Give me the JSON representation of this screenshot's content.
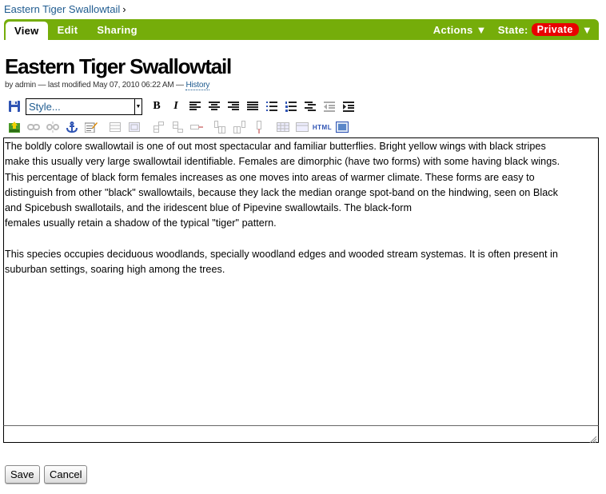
{
  "breadcrumb": {
    "link": "Eastern Tiger Swallowtail",
    "separator": "›"
  },
  "editbar": {
    "tabs": [
      {
        "label": "View"
      },
      {
        "label": "Edit"
      },
      {
        "label": "Sharing"
      }
    ],
    "actions_label": "Actions",
    "actions_arrow": "▼",
    "state_label": "State:",
    "state_value": "Private",
    "state_arrow": "▼",
    "colors": {
      "bar": "#75ad0a",
      "state_badge": "#e90000"
    }
  },
  "page": {
    "title": "Eastern Tiger Swallowtail",
    "byline_prefix": "by admin — last modified May 07, 2010 06:22 AM —",
    "history_link": "History"
  },
  "toolbar": {
    "style_select_value": "Style...",
    "bold_label": "B",
    "italic_label": "I",
    "html_label": "HTML"
  },
  "editor": {
    "paragraph1_lines": [
      "The boldly colore swallowtail is one of out most spectacular and familiar butterflies. Bright yellow wings with black stripes",
      "make this usually very large swallowtail identifiable. Females are dimorphic (have two forms) with some having black wings.",
      "This percentage of black form females increases as one moves into areas of warmer climate. These forms are easy to",
      "distinguish from other \"black\" swallowtails, because they lack the median orange spot-band on the hindwing, seen on Black",
      "and Spicebush swallotails, and the iridescent blue of Pipevine swallowtails. The black-form",
      "females usually retain a shadow of the typical \"tiger\" pattern."
    ],
    "paragraph2_lines": [
      "This species occupies deciduous woodlands, specially woodland edges and wooded stream systemas. It is often present in",
      "suburban settings, soaring high among the trees."
    ]
  },
  "form": {
    "save_label": "Save",
    "cancel_label": "Cancel"
  }
}
